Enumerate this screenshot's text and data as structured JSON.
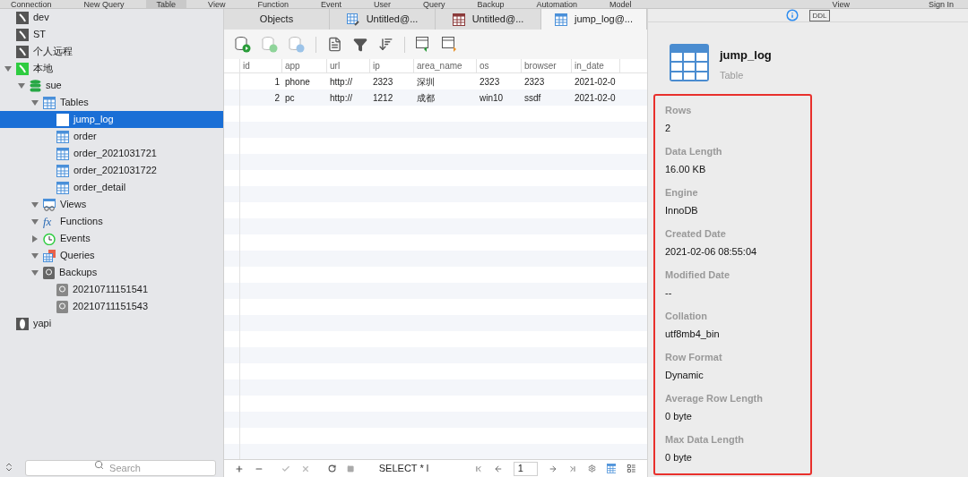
{
  "menu_bar": {
    "left": [
      {
        "label": "Connection",
        "selected": false
      },
      {
        "label": "New Query",
        "selected": false
      },
      {
        "label": "Table",
        "selected": true
      },
      {
        "label": "View",
        "selected": false
      },
      {
        "label": "Function",
        "selected": false
      },
      {
        "label": "Event",
        "selected": false
      },
      {
        "label": "User",
        "selected": false
      },
      {
        "label": "Query",
        "selected": false
      },
      {
        "label": "Backup",
        "selected": false
      },
      {
        "label": "Automation",
        "selected": false
      },
      {
        "label": "Model",
        "selected": false
      }
    ],
    "right": [
      {
        "label": "View",
        "selected": false
      },
      {
        "label": "Sign In",
        "selected": false
      }
    ]
  },
  "sidebar": {
    "tree": [
      {
        "label": "dev",
        "kind": "connection",
        "selected": false
      },
      {
        "label": "ST",
        "kind": "connection",
        "selected": false
      },
      {
        "label": "个人远程",
        "kind": "connection",
        "selected": false
      },
      {
        "label": "本地",
        "kind": "connection_open",
        "selected": false,
        "expanded": true,
        "children": [
          {
            "label": "sue",
            "kind": "database",
            "selected": false,
            "expanded": true,
            "children": [
              {
                "label": "Tables",
                "kind": "tables",
                "selected": false,
                "expanded": true,
                "children": [
                  {
                    "label": "jump_log",
                    "kind": "table",
                    "selected": true
                  },
                  {
                    "label": "order",
                    "kind": "table",
                    "selected": false
                  },
                  {
                    "label": "order_2021031721",
                    "kind": "table",
                    "selected": false
                  },
                  {
                    "label": "order_2021031722",
                    "kind": "table",
                    "selected": false
                  },
                  {
                    "label": "order_detail",
                    "kind": "table",
                    "selected": false
                  }
                ]
              },
              {
                "label": "Views",
                "kind": "views",
                "selected": false,
                "expanded": true
              },
              {
                "label": "Functions",
                "kind": "functions",
                "icon": "fx",
                "selected": false,
                "expanded": true
              },
              {
                "label": "Events",
                "kind": "events",
                "selected": false,
                "expanded": false
              },
              {
                "label": "Queries",
                "kind": "queries",
                "selected": false,
                "expanded": true
              },
              {
                "label": "Backups",
                "kind": "backups",
                "selected": false,
                "expanded": true,
                "children": [
                  {
                    "label": "20210711151541",
                    "kind": "backup",
                    "selected": false
                  },
                  {
                    "label": "20210711151543",
                    "kind": "backup",
                    "selected": false
                  }
                ]
              }
            ]
          }
        ]
      },
      {
        "label": "yapi",
        "kind": "mongo",
        "selected": false
      }
    ],
    "search": {
      "placeholder": "Search"
    }
  },
  "tabs": [
    {
      "label": "Objects",
      "kind": "objects",
      "selected": false
    },
    {
      "label": "Untitled@...",
      "kind": "query",
      "selected": false
    },
    {
      "label": "Untitled@...",
      "kind": "query_result",
      "selected": false
    },
    {
      "label": "jump_log@...",
      "kind": "table",
      "selected": true
    }
  ],
  "grid": {
    "columns": [
      "id",
      "app",
      "url",
      "ip",
      "area_name",
      "os",
      "browser",
      "in_date"
    ],
    "rows": [
      [
        "1",
        "phone",
        "http://",
        "2323",
        "深圳",
        "2323",
        "2323",
        "2021-02-0"
      ],
      [
        "2",
        "pc",
        "http://",
        "1212",
        "成都",
        "win10",
        "ssdf",
        "2021-02-0"
      ]
    ]
  },
  "bottom_bar": {
    "query": "SELECT * l",
    "page": "1"
  },
  "info_panel": {
    "tabs": [
      {
        "kind": "info",
        "selected": true
      },
      {
        "kind": "ddl",
        "label": "DDL",
        "selected": false
      }
    ],
    "object": {
      "name": "jump_log",
      "type": "Table"
    },
    "properties": [
      {
        "label": "Rows",
        "value": "2"
      },
      {
        "label": "Data Length",
        "value": "16.00 KB"
      },
      {
        "label": "Engine",
        "value": "InnoDB"
      },
      {
        "label": "Created Date",
        "value": "2021-02-06 08:55:04"
      },
      {
        "label": "Modified Date",
        "value": "--"
      },
      {
        "label": "Collation",
        "value": "utf8mb4_bin"
      },
      {
        "label": "Row Format",
        "value": "Dynamic"
      },
      {
        "label": "Average Row Length",
        "value": "0 byte"
      },
      {
        "label": "Max Data Length",
        "value": "0 byte"
      }
    ]
  }
}
